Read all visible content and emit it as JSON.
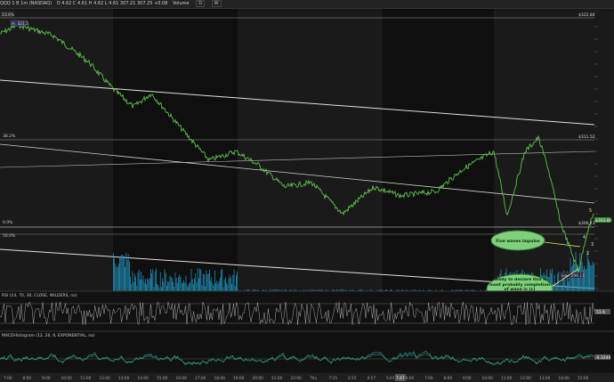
{
  "header": {
    "symbol": "QQQ 1 B 1m (NASDAQ)",
    "ohlc": "O 4.62   C 4.61   H 4.62   L 4.61   307.21   307.25   +0.08",
    "study_label": "Volume",
    "buttons": [
      "D",
      "W"
    ]
  },
  "price_panel": {
    "top_left_tag": "23.6%",
    "high_box": "H: 321.5",
    "fib_left": [
      "38.2%",
      "0.0%",
      "50.0%"
    ],
    "right_tags": [
      "$322.84",
      "$311.52",
      "$306.43",
      "$303.80"
    ],
    "low_box": "low: 299.11",
    "annotations": [
      {
        "text": "Five waves impulse"
      },
      {
        "text": "Ready to declare this is most probably completion of wave iv (c)"
      }
    ],
    "wave_marks": [
      "5",
      "4",
      "3",
      "2"
    ],
    "accent_color": "#f0e68c"
  },
  "rsi_panel": {
    "label": "RSI (14, 70, 30, CLOSE, WILDERS, no)",
    "right_tag": "51.6"
  },
  "macd_panel": {
    "label": "MACDHistogram (12, 26, 9, EXPONENTIAL, no)",
    "right_tag": "-0.3244"
  },
  "time_axis": [
    "7:00",
    "8:00",
    "9:00",
    "10:00",
    "11:00",
    "12:00",
    "13:00",
    "14:00",
    "15:00",
    "16:00",
    "17:00",
    "18:00",
    "19:00",
    "20:00",
    "21:00",
    "22:00",
    "Thu",
    "7:15",
    "2:15",
    "4:17",
    "5:01",
    "6:00",
    "7:00",
    "8:00",
    "9:00",
    "10:00",
    "11:00",
    "12:00",
    "13:00",
    "14:00",
    "15:00"
  ],
  "session_bar": "7:47"
}
